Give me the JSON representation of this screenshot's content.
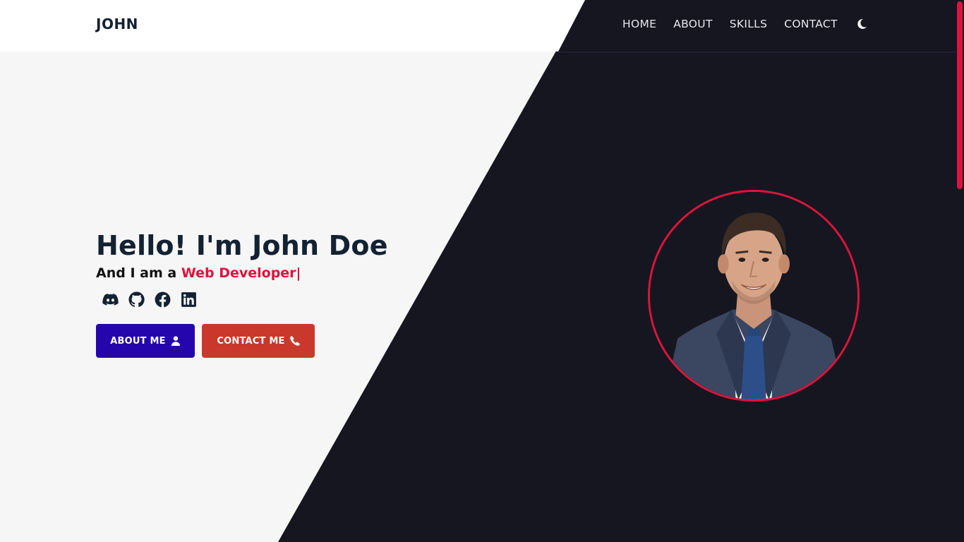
{
  "header": {
    "logo": "JOHN",
    "nav": [
      "HOME",
      "ABOUT",
      "SKILLS",
      "CONTACT"
    ],
    "theme_icon": "moon-icon"
  },
  "hero": {
    "title": "Hello! I'm John Doe",
    "subtitle_prefix": "And I am a ",
    "subtitle_role": "Web Developer|",
    "socials": [
      "discord-icon",
      "github-icon",
      "facebook-icon",
      "linkedin-icon"
    ],
    "buttons": {
      "about": "ABOUT ME",
      "contact": "CONTACT ME"
    }
  },
  "colors": {
    "accent": "#dc143c",
    "dark_bg": "#151620",
    "about_button": "#2506ad",
    "contact_button": "#c9392b",
    "text_dark": "#132232"
  }
}
